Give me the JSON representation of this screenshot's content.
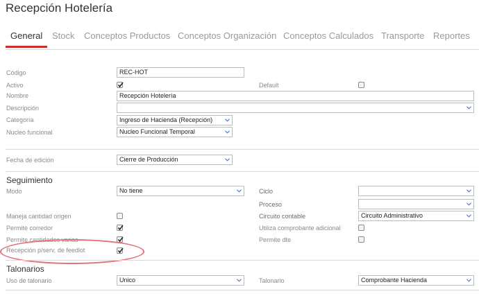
{
  "page": {
    "title": "Recepción Hotelería"
  },
  "tabs": [
    {
      "label": "General"
    },
    {
      "label": "Stock"
    },
    {
      "label": "Conceptos Productos"
    },
    {
      "label": "Conceptos Organización"
    },
    {
      "label": "Conceptos Calculados"
    },
    {
      "label": "Transporte"
    },
    {
      "label": "Reportes"
    }
  ],
  "general": {
    "codigo_label": "Código",
    "codigo_value": "REC-HOT",
    "activo_label": "Activo",
    "activo_checked": true,
    "default_label": "Default",
    "default_checked": false,
    "nombre_label": "Nombre",
    "nombre_value": "Recepción Hotelería",
    "descripcion_label": "Descripción",
    "descripcion_value": "",
    "categoria_label": "Categoría",
    "categoria_value": "Ingreso de Hacienda (Recepción)",
    "nucleo_label": "Nucleo funcional",
    "nucleo_value": "Nucleo Funcional Temporal",
    "fecha_label": "Fecha de edición",
    "fecha_value": "Cierre de Producción"
  },
  "seguimiento": {
    "title": "Seguimiento",
    "modo_label": "Modo",
    "modo_value": "No tiene",
    "ciclo_label": "Ciclo",
    "ciclo_value": "",
    "proceso_label": "Proceso",
    "proceso_value": "",
    "circuito_label": "Circuito contable",
    "circuito_value": "Circuito Administrativo",
    "maneja_label": "Maneja cantidad origen",
    "maneja_checked": false,
    "utiliza_label": "Utiliza comprobante adicional",
    "utiliza_checked": false,
    "corredor_label": "Permite corredor",
    "corredor_checked": true,
    "cantidades_label": "Permite cantidades varias",
    "cantidades_checked": true,
    "dte_label": "Permite dte",
    "dte_checked": false,
    "feedlot_label": "Recepción p/serv. de feedlot",
    "feedlot_checked": true
  },
  "talonarios": {
    "title": "Talonarios",
    "uso_label": "Uso de talonario",
    "uso_value": "Unico",
    "talonario_label": "Talonario",
    "talonario_value": "Comprobante Hacienda"
  },
  "icons": {
    "checkmark": "checkmark-icon",
    "dropdown": "chevron-down-icon"
  },
  "colors": {
    "accent": "#c9302c",
    "annotation": "#e0707a"
  }
}
